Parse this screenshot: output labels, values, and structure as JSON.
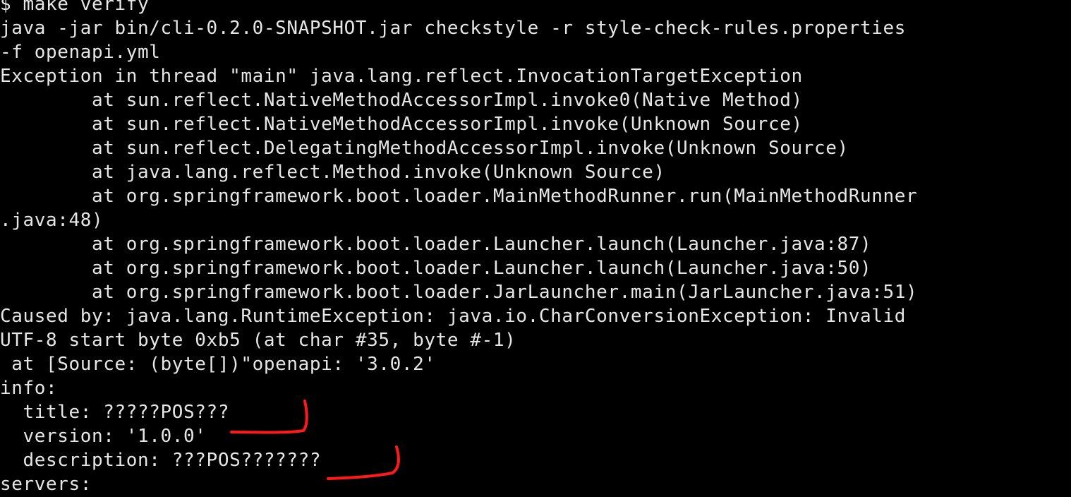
{
  "terminal": {
    "lines": [
      "$ make verify",
      "java -jar bin/cli-0.2.0-SNAPSHOT.jar checkstyle -r style-check-rules.properties",
      "-f openapi.yml",
      "Exception in thread \"main\" java.lang.reflect.InvocationTargetException",
      "        at sun.reflect.NativeMethodAccessorImpl.invoke0(Native Method)",
      "        at sun.reflect.NativeMethodAccessorImpl.invoke(Unknown Source)",
      "        at sun.reflect.DelegatingMethodAccessorImpl.invoke(Unknown Source)",
      "        at java.lang.reflect.Method.invoke(Unknown Source)",
      "        at org.springframework.boot.loader.MainMethodRunner.run(MainMethodRunner",
      ".java:48)",
      "        at org.springframework.boot.loader.Launcher.launch(Launcher.java:87)",
      "        at org.springframework.boot.loader.Launcher.launch(Launcher.java:50)",
      "        at org.springframework.boot.loader.JarLauncher.main(JarLauncher.java:51)",
      "Caused by: java.lang.RuntimeException: java.io.CharConversionException: Invalid",
      "UTF-8 start byte 0xb5 (at char #35, byte #-1)",
      " at [Source: (byte[])\"openapi: '3.0.2'",
      "info:",
      "  title: ?????POS???",
      "  version: '1.0.0'",
      "  description: ???POS???????",
      "servers:"
    ]
  },
  "annotation_color": "#ff1a1a"
}
